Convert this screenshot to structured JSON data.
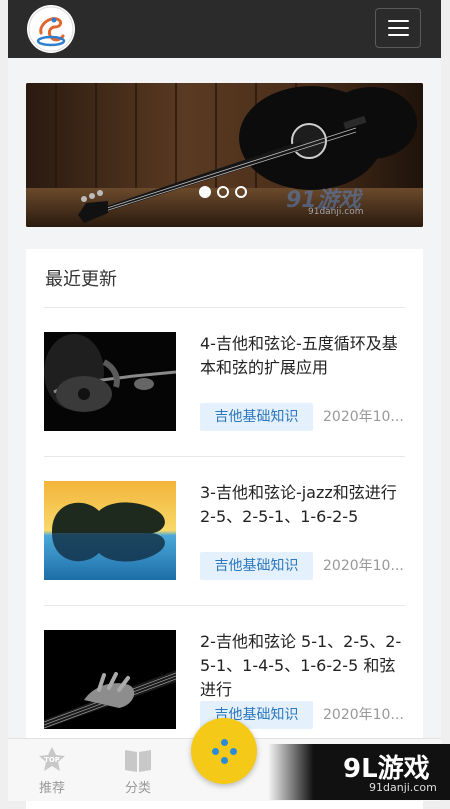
{
  "section_title": "最近更新",
  "articles": [
    {
      "title": "4-吉他和弦论-五度循环及基本和弦的扩展应用",
      "tag": "吉他基础知识",
      "date": "2020年10..."
    },
    {
      "title": "3-吉他和弦论-jazz和弦进行2-5、2-5-1、1-6-2-5",
      "tag": "吉他基础知识",
      "date": "2020年10..."
    },
    {
      "title": "2-吉他和弦论 5-1、2-5、2-5-1、1-4-5、1-6-2-5 和弦进行",
      "tag": "吉他基础知识",
      "date": "2020年10..."
    }
  ],
  "bottom_nav": [
    {
      "label": "推荐",
      "icon": "top-badge-icon"
    },
    {
      "label": "分类",
      "icon": "book-icon"
    }
  ],
  "banner": {
    "watermark": "91游戏",
    "watermark_sub": "91danji.com",
    "active_dot": 0,
    "dot_count": 3
  },
  "corner_watermark": {
    "text": "9L游戏",
    "sub": "91danji.com"
  },
  "colors": {
    "topbar": "#2b2b2b",
    "tag_bg": "#e4f0fb",
    "tag_text": "#2c78bf",
    "fab": "#f5c918"
  }
}
